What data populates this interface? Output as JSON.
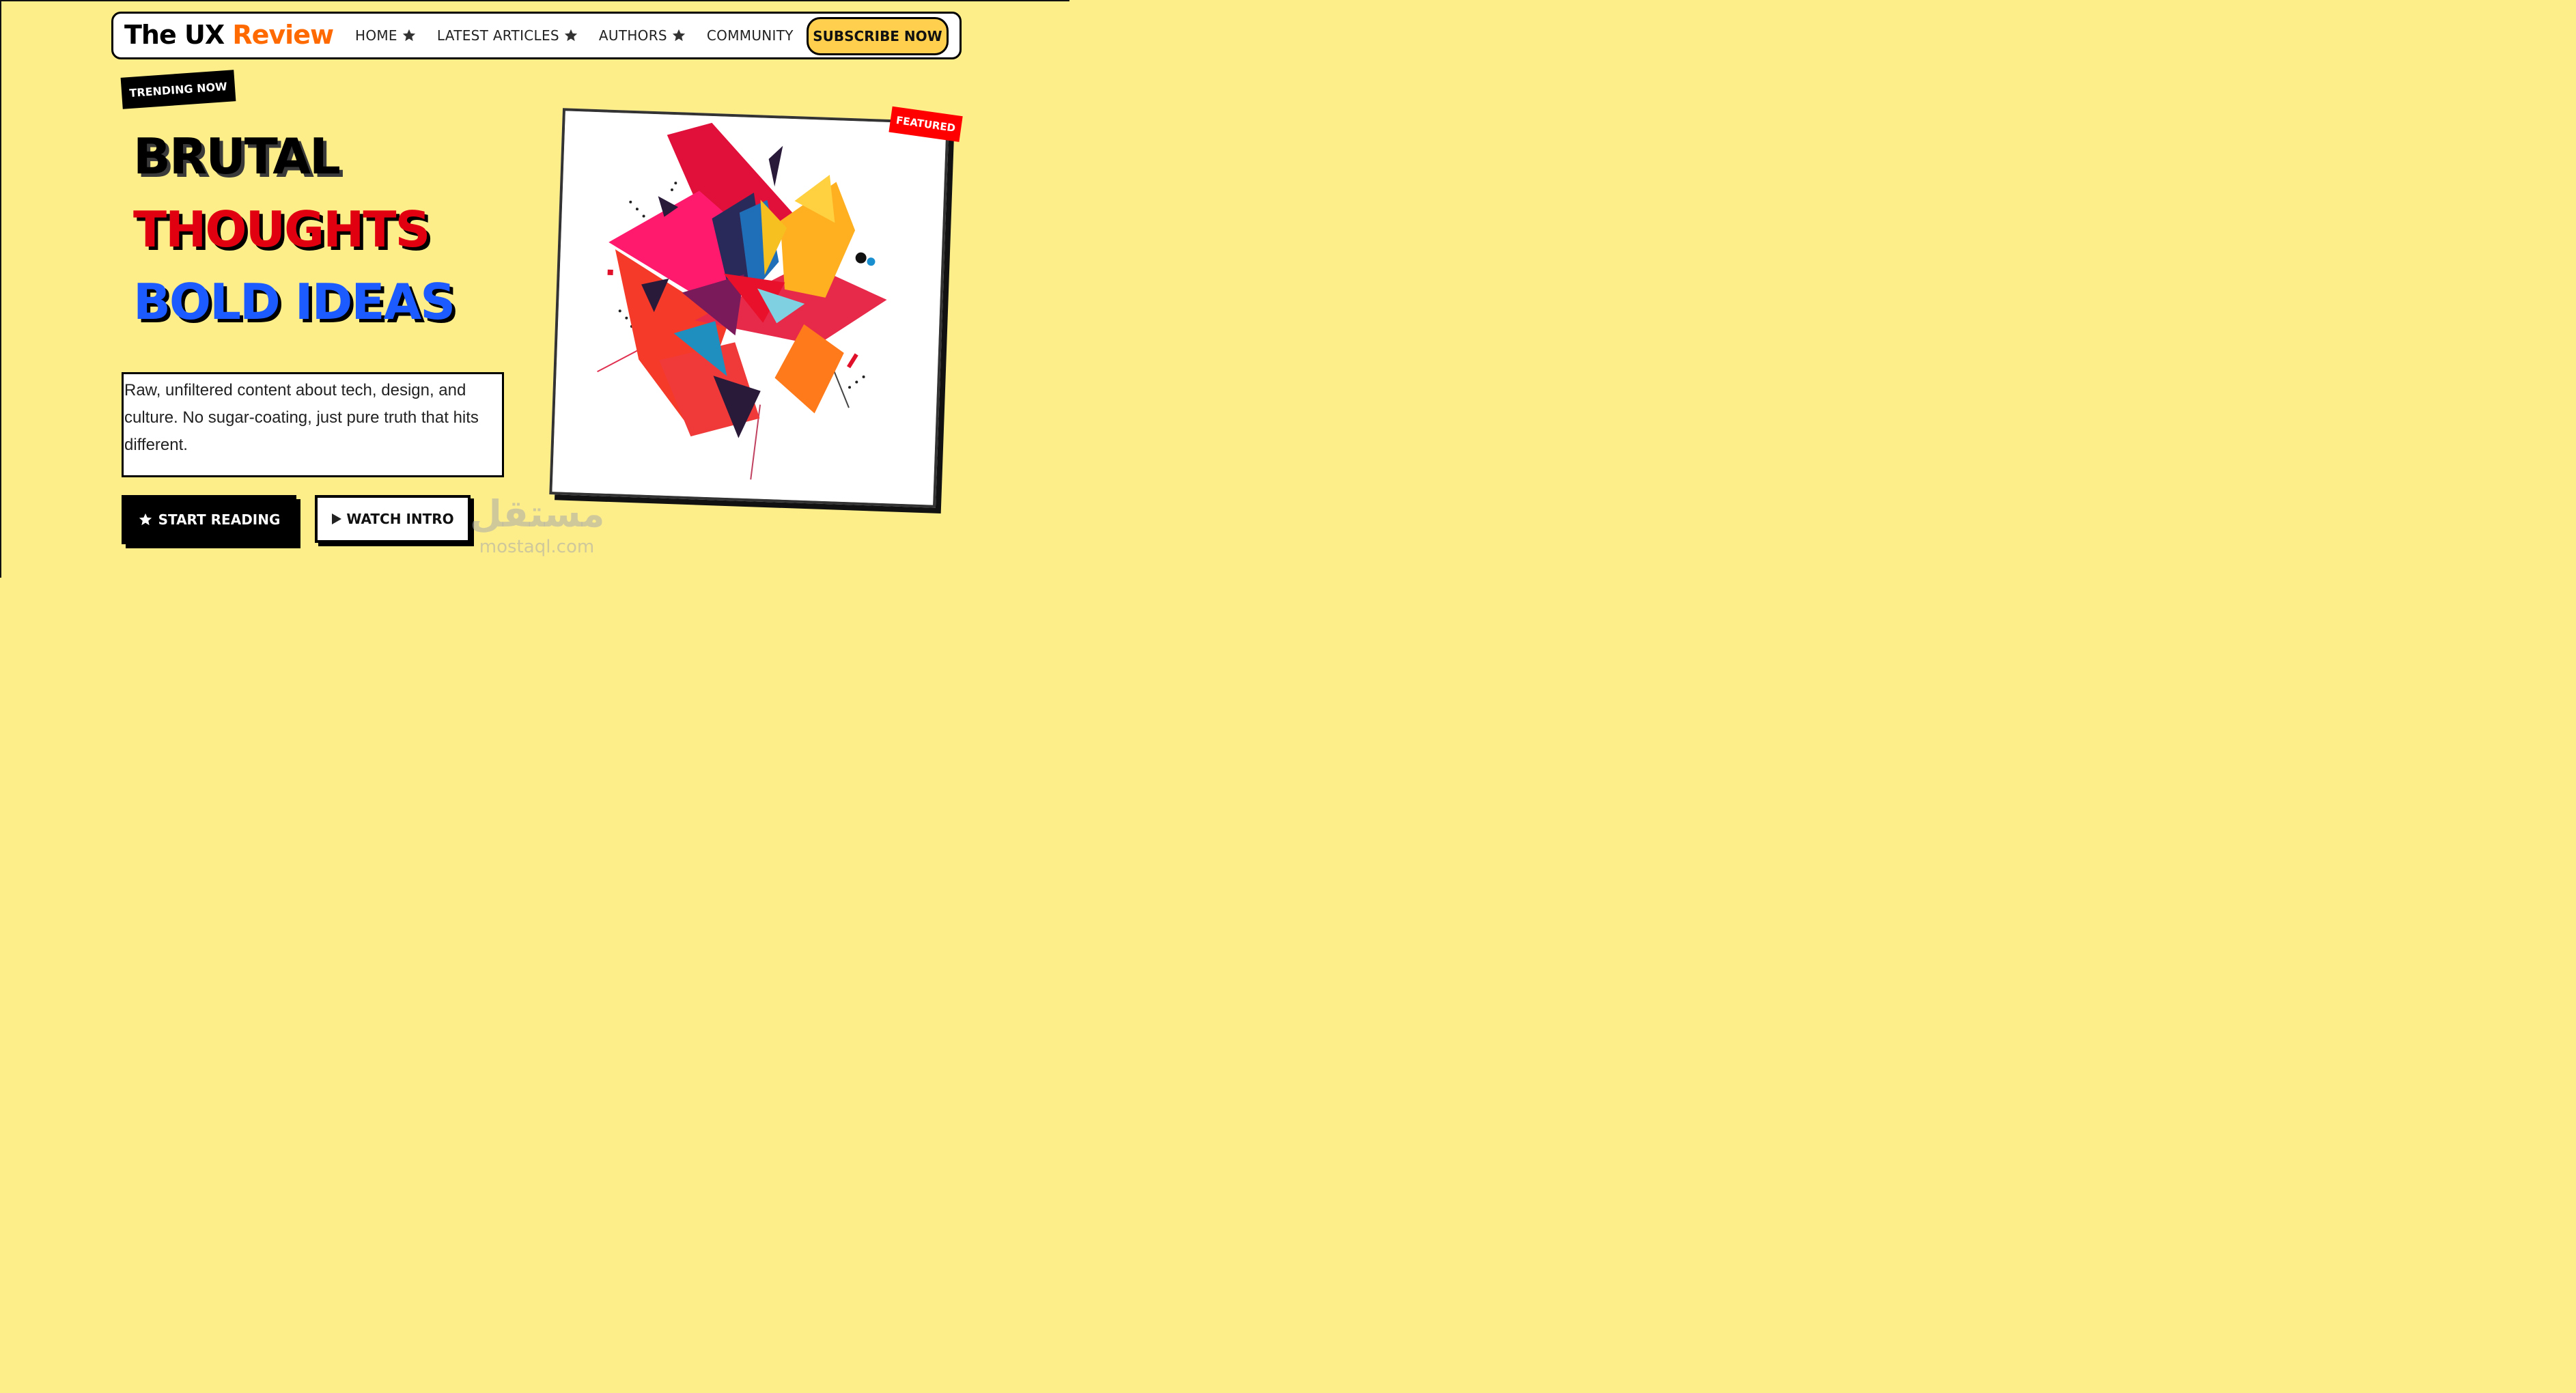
{
  "brand": {
    "name_part1": "The UX ",
    "name_part2": "Review",
    "accent_color": "#ff6a00"
  },
  "nav": {
    "items": [
      {
        "label": "HOME",
        "icon": "star-icon"
      },
      {
        "label": "LATEST ARTICLES",
        "icon": "star-icon"
      },
      {
        "label": "AUTHORS",
        "icon": "star-icon"
      },
      {
        "label": "COMMUNITY"
      }
    ],
    "subscribe_label": "SUBSCRIBE NOW"
  },
  "hero": {
    "tag": "TRENDING NOW",
    "headline": [
      "BRUTAL",
      "THOUGHTS",
      "BOLD IDEAS"
    ],
    "headline_colors": [
      "#000000",
      "#e0000f",
      "#1c5bff"
    ],
    "description": "Raw, unfiltered content about tech, design, and culture. No sugar-coating, just pure truth that hits different.",
    "primary_button": {
      "label": "START READING",
      "icon": "star-icon"
    },
    "secondary_button": {
      "label": "WATCH INTRO",
      "icon": "play-icon"
    }
  },
  "featured": {
    "tag": "FEATURED",
    "image": "abstract-geometric-art"
  },
  "watermark": {
    "arabic": "مستقل",
    "latin": "mostaql.com"
  },
  "colors": {
    "background": "#fdee8a",
    "subscribe_bg": "#ffcf4d",
    "featured_tag": "#ff0000"
  }
}
